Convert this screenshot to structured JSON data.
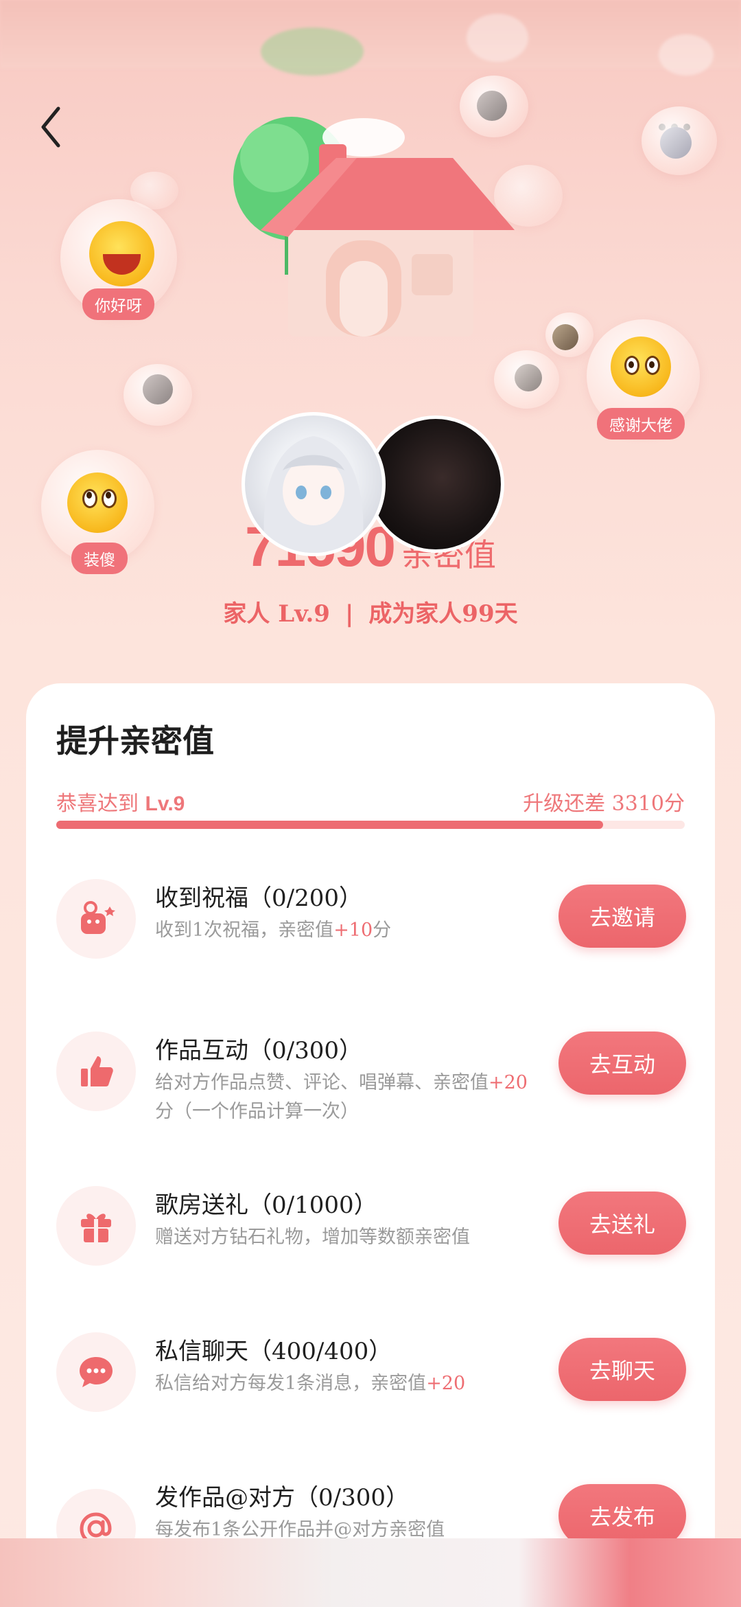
{
  "nav": {
    "back_icon": "chevron-left-icon",
    "more_icon": "more-horizontal-icon"
  },
  "stickers": [
    {
      "tag": "你好呀"
    },
    {
      "tag": "感谢大佬"
    },
    {
      "tag": "装傻"
    }
  ],
  "intimacy": {
    "value": "71690",
    "unit": "亲密值",
    "relation_level": "家人 Lv.9",
    "separator": "|",
    "days_text": "成为家人99天"
  },
  "card": {
    "title": "提升亲密值",
    "progress_prefix": "恭喜达到",
    "progress_level": "Lv.9",
    "progress_right": "升级还差 3310分",
    "progress_fraction": 0.87
  },
  "tasks": [
    {
      "title": "收到祝福（0/200）",
      "desc": "收到1次祝福，亲密值",
      "hl": "+10",
      "desc_tail": "分",
      "button": "去邀请",
      "icon": "blessing-icon"
    },
    {
      "title": "作品互动（0/300）",
      "desc": "给对方作品点赞、评论、唱弹幕、亲密值",
      "hl": "+20",
      "desc_tail": "分（一个作品计算一次）",
      "button": "去互动",
      "icon": "thumbs-up-icon"
    },
    {
      "title": "歌房送礼（0/1000）",
      "desc": "赠送对方钻石礼物，增加等数额亲密值",
      "hl": "",
      "desc_tail": "",
      "button": "去送礼",
      "icon": "gift-icon"
    },
    {
      "title": "私信聊天（400/400）",
      "desc": "私信给对方每发1条消息，亲密值",
      "hl": "+20",
      "desc_tail": "",
      "button": "去聊天",
      "icon": "chat-bubble-icon"
    },
    {
      "title": "发作品@对方（0/300）",
      "desc": "每发布1条公开作品并@对方亲密值",
      "hl": "",
      "desc_tail": "",
      "button": "去发布",
      "icon": "at-sign-icon"
    }
  ],
  "colors": {
    "accent": "#ee6a6d",
    "button": "#ec666c",
    "background": "#fde4dc"
  }
}
